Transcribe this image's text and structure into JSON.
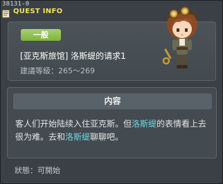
{
  "window": {
    "id_label": "38131-0",
    "title": "QUEST INFO",
    "title_color": "#f2e25a"
  },
  "quest": {
    "category_badge": "一般",
    "badge_color": "#8fc04e",
    "title": "[亚克斯旅馆] 洛斯缇的请求1",
    "level_label": "建議等級：265～269"
  },
  "content": {
    "header": "内容",
    "text_1": "客人们开始陆续入住亚克斯。但",
    "npc_name_1": "洛斯缇",
    "text_2": "的表情看上去很为难。去和",
    "npc_name_2": "洛斯缇",
    "text_3": "聊聊吧。",
    "npc_name_color": "#6fd6e6"
  },
  "status": {
    "label": "狀態：",
    "value": "可開始"
  },
  "icons": {
    "title_icon": "quest-book-icon",
    "npc_sprite": "npc-character-sprite"
  }
}
